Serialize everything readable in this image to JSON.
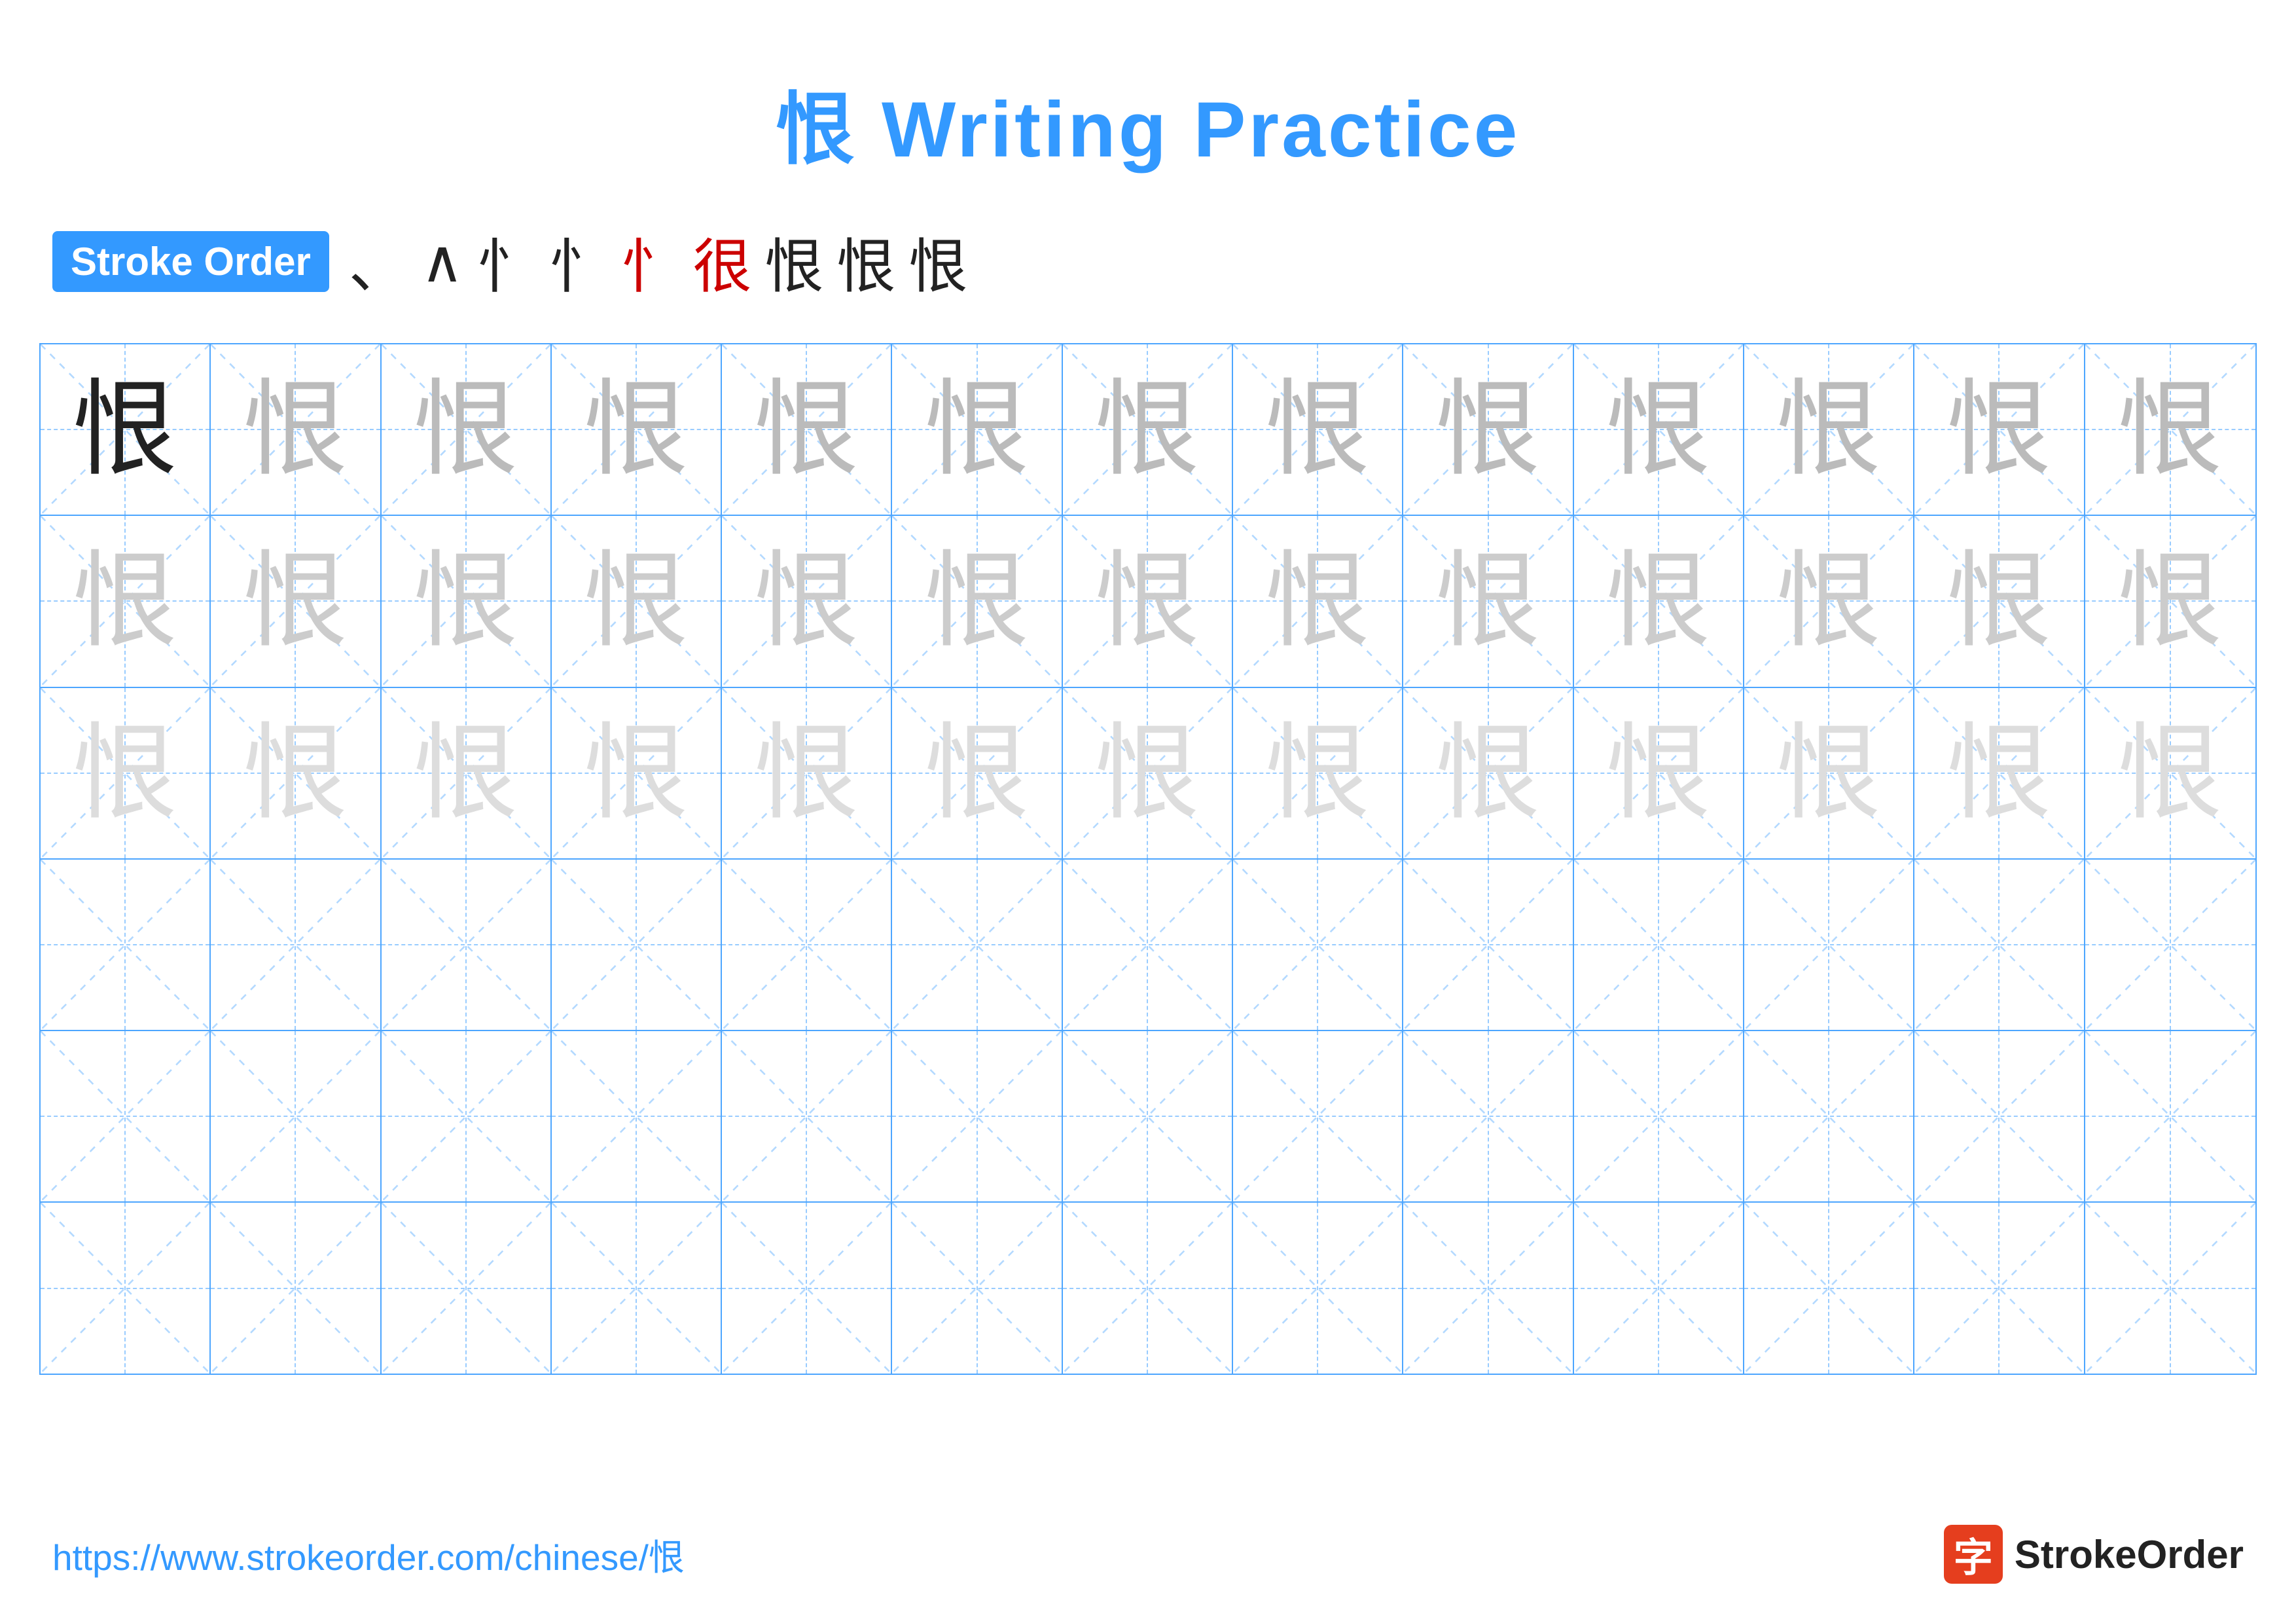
{
  "page": {
    "title": "恨 Writing Practice",
    "title_char": "恨",
    "title_text": " Writing Practice",
    "stroke_order_label": "Stroke Order",
    "stroke_sequence": [
      "·",
      "∧",
      "忄",
      "忄7",
      "忄𠃊",
      "忄𠃌",
      "恨",
      "恨",
      "恨"
    ],
    "character": "恨",
    "url": "https://www.strokeorder.com/chinese/恨",
    "logo_text": "StrokeOrder",
    "grid": {
      "rows": 6,
      "cols": 13,
      "row_data": [
        {
          "type": "dark-then-light1",
          "char_count": 13
        },
        {
          "type": "light2",
          "char_count": 13
        },
        {
          "type": "light3",
          "char_count": 13
        },
        {
          "type": "empty",
          "char_count": 13
        },
        {
          "type": "empty",
          "char_count": 13
        },
        {
          "type": "empty",
          "char_count": 13
        }
      ]
    }
  }
}
